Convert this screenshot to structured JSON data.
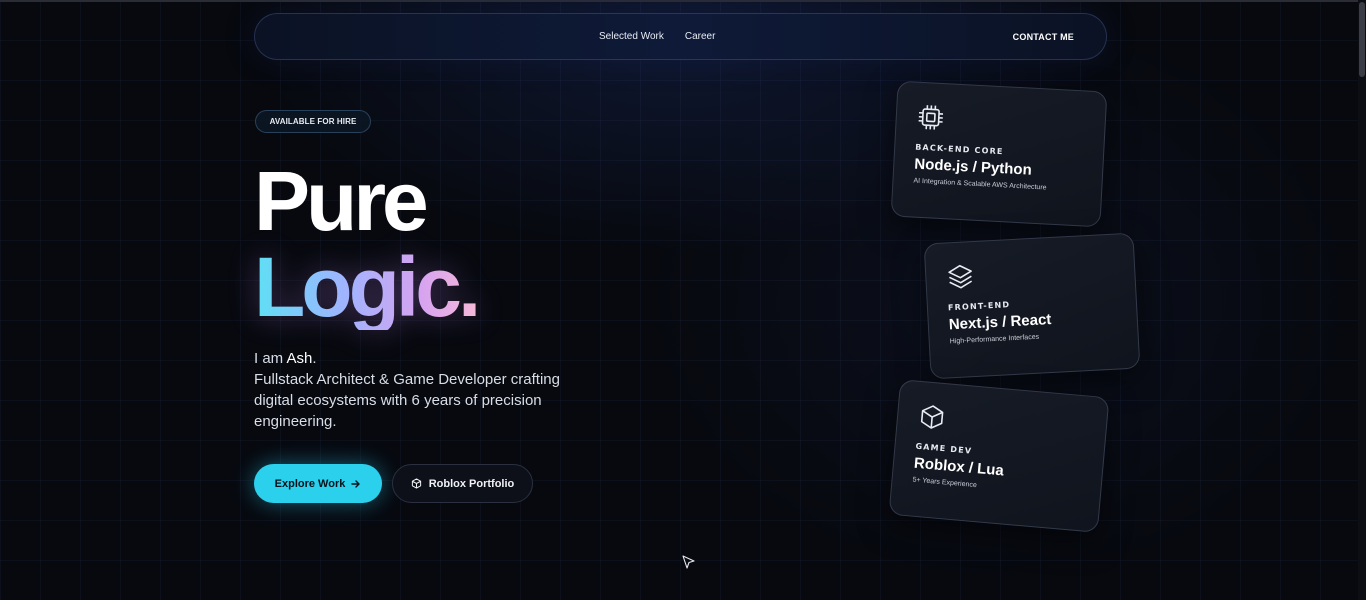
{
  "nav": {
    "links": [
      "Selected Work",
      "Career"
    ],
    "contact": "CONTACT ME"
  },
  "badge": "AVAILABLE FOR HIRE",
  "hero": {
    "title_line1": "Pure",
    "title_line2": "Logic.",
    "intro_prefix": "I am ",
    "name": "Ash",
    "intro_suffix": ".",
    "description": "Fullstack Architect & Game Developer crafting digital ecosystems with 6 years of precision engineering."
  },
  "buttons": {
    "primary": {
      "label": "Explore Work",
      "icon": "arrow-right-icon"
    },
    "secondary": {
      "label": "Roblox Portfolio",
      "icon": "cube-icon"
    }
  },
  "cards": [
    {
      "icon": "cpu-chip-icon",
      "category": "BACK-END CORE",
      "title": "Node.js / Python",
      "subtitle": "AI Integration & Scalable AWS Architecture"
    },
    {
      "icon": "layers-icon",
      "category": "FRONT-END",
      "title": "Next.js / React",
      "subtitle": "High-Performance Interfaces"
    },
    {
      "icon": "cube-icon",
      "category": "GAME DEV",
      "title": "Roblox / Lua",
      "subtitle": "5+ Years Experience"
    }
  ],
  "colors": {
    "background": "#07090f",
    "accent": "#2ad0ec",
    "gradient_start": "#5ee0f5",
    "gradient_end": "#f4b8d8"
  }
}
